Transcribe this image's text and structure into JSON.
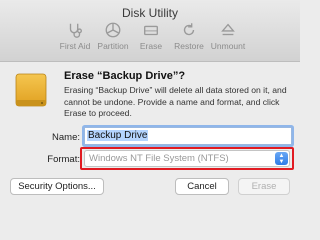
{
  "window": {
    "title": "Disk Utility"
  },
  "toolbar": {
    "items": [
      {
        "label": "First Aid",
        "icon": "stethoscope-icon"
      },
      {
        "label": "Partition",
        "icon": "partition-icon"
      },
      {
        "label": "Erase",
        "icon": "erase-icon"
      },
      {
        "label": "Restore",
        "icon": "restore-icon"
      },
      {
        "label": "Unmount",
        "icon": "eject-icon"
      }
    ]
  },
  "dialog": {
    "title": "Erase “Backup Drive”?",
    "message": "Erasing “Backup Drive” will delete all data stored on it, and cannot be undone. Provide a name and format, and click Erase to proceed.",
    "drive_icon": "external-drive-icon",
    "name_label": "Name:",
    "name_value": "Backup Drive",
    "format_label": "Format:",
    "format_value": "Windows NT File System (NTFS)",
    "highlight_color": "#e11b22",
    "buttons": {
      "security": "Security Options...",
      "cancel": "Cancel",
      "erase": "Erase"
    }
  }
}
